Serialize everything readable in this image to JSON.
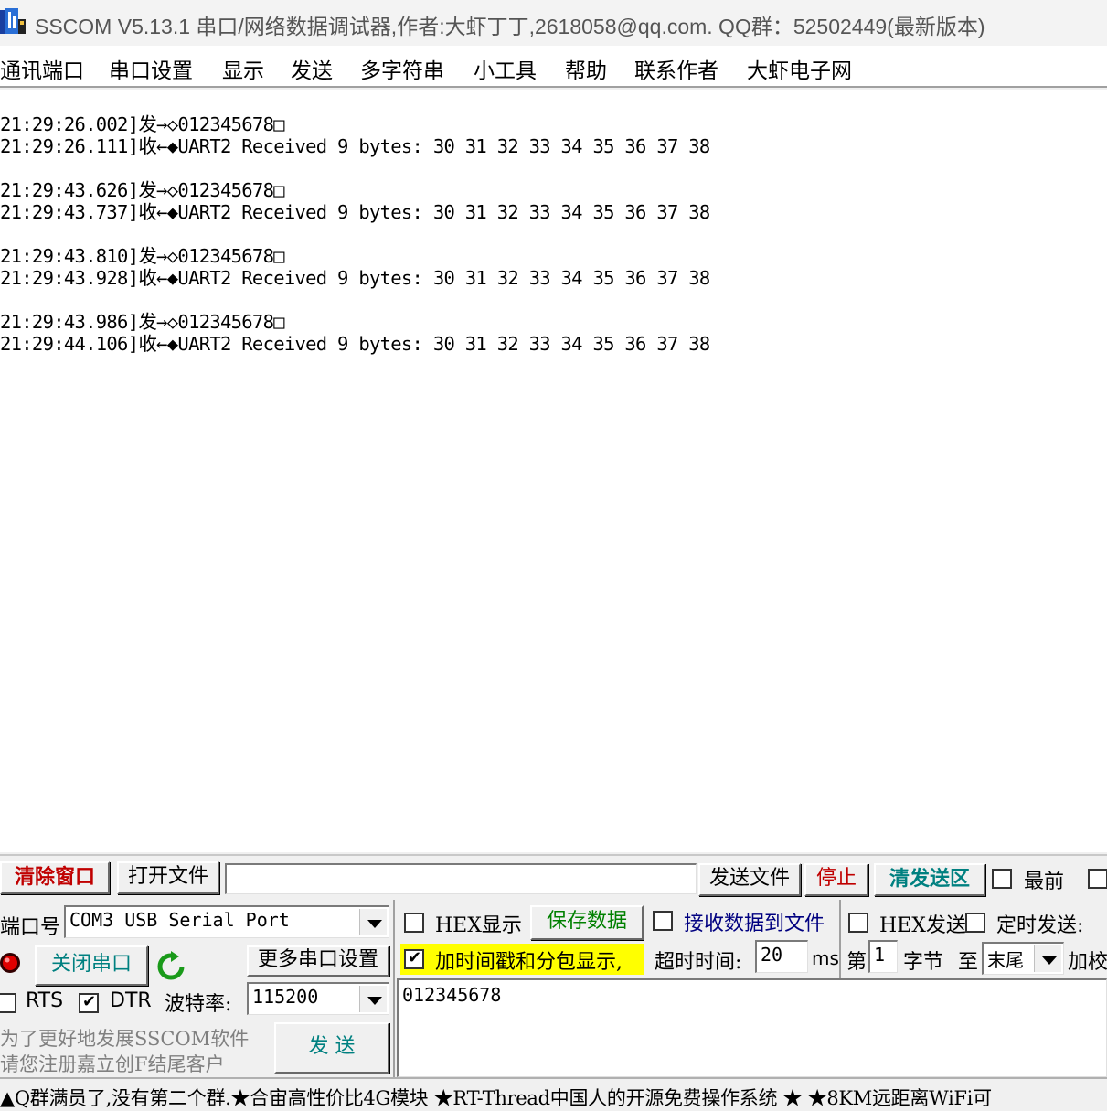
{
  "window": {
    "title": "SSCOM V5.13.1 串口/网络数据调试器,作者:大虾丁丁,2618058@qq.com. QQ群：52502449(最新版本)",
    "icon": "sscom-app-icon"
  },
  "menu": {
    "items": [
      "通讯端口",
      "串口设置",
      "显示",
      "发送",
      "多字符串",
      "小工具",
      "帮助",
      "联系作者",
      "大虾电子网"
    ]
  },
  "log": {
    "entries": [
      {
        "tx": "21:29:26.002]发→◇012345678□",
        "rx": "21:29:26.111]收←◆UART2 Received 9 bytes: 30 31 32 33 34 35 36 37 38"
      },
      {
        "tx": "21:29:43.626]发→◇012345678□",
        "rx": "21:29:43.737]收←◆UART2 Received 9 bytes: 30 31 32 33 34 35 36 37 38"
      },
      {
        "tx": "21:29:43.810]发→◇012345678□",
        "rx": "21:29:43.928]收←◆UART2 Received 9 bytes: 30 31 32 33 34 35 36 37 38"
      },
      {
        "tx": "21:29:43.986]发→◇012345678□",
        "rx": "21:29:44.106]收←◆UART2 Received 9 bytes: 30 31 32 33 34 35 36 37 38"
      }
    ]
  },
  "toolbar": {
    "clear_window": "清除窗口",
    "open_file": "打开文件",
    "file_path": "",
    "send_file": "发送文件",
    "stop": "停止",
    "clear_send": "清发送区",
    "topmost_label": "最前",
    "topmost_checked": false
  },
  "port": {
    "port_label": "端口号",
    "port_value": "COM3 USB Serial Port",
    "close_port": "关闭串口",
    "more_settings": "更多串口设置",
    "rts_label": "RTS",
    "rts_checked": false,
    "dtr_label": "DTR",
    "dtr_checked": true,
    "baud_label": "波特率:",
    "baud_value": "115200",
    "ad_line1": "为了更好地发展SSCOM软件",
    "ad_line2": "请您注册嘉立创F结尾客户",
    "send_button": "发  送"
  },
  "options": {
    "hex_display_label": "HEX显示",
    "hex_display_checked": false,
    "save_data": "保存数据",
    "recv_to_file_label": "接收数据到文件",
    "recv_to_file_checked": false,
    "hex_send_label": "HEX发送",
    "hex_send_checked": false,
    "timed_send_label": "定时发送:",
    "timed_send_checked": false,
    "timestamp_label": "加时间戳和分包显示,",
    "timestamp_checked": true,
    "timeout_label": "超时时间:",
    "timeout_value": "20",
    "timeout_unit": "ms",
    "nth_label": "第",
    "nth_value": "1",
    "byte_label": "字节",
    "to_label": "至",
    "end_value": "末尾",
    "checksum_label": "加校"
  },
  "send_area": {
    "text": "012345678"
  },
  "status": {
    "marquee": "▲Q群满员了,没有第二个群.★合宙高性价比4G模块 ★RT-Thread中国人的开源免费操作系统 ★ ★8KM远距离WiFi可"
  },
  "colors": {
    "clear_window_text": "#c00000",
    "stop_text": "#c00000",
    "clear_send_text": "#008080",
    "save_data_text": "#008000",
    "recv_file_text": "#000080",
    "close_port_text": "#008080",
    "send_text": "#008080",
    "highlight": "#ffff00"
  }
}
